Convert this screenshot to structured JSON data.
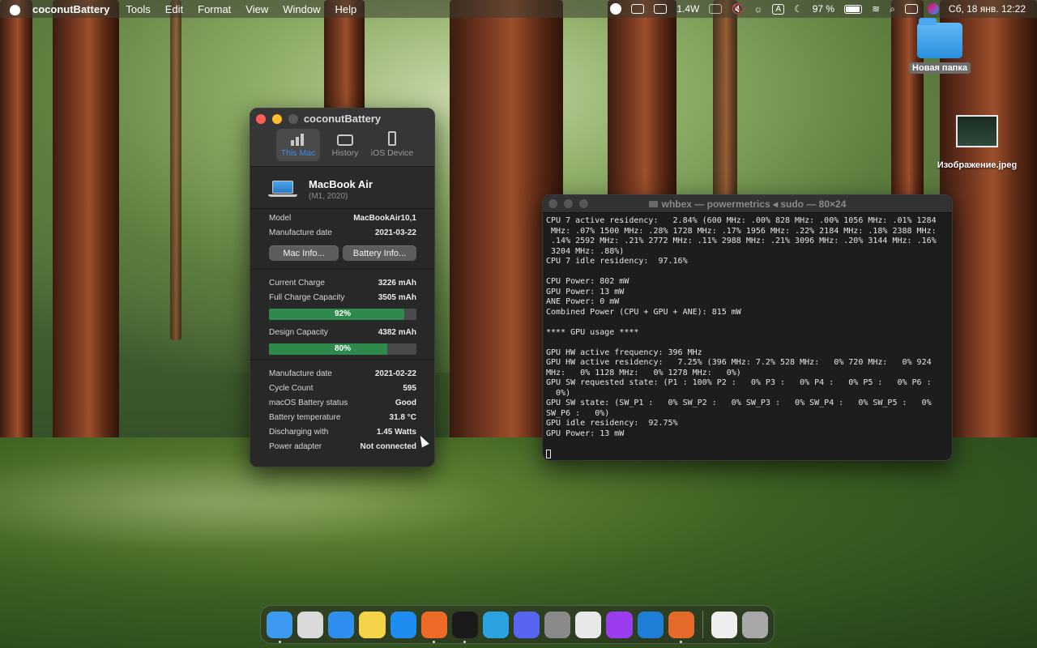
{
  "menubar": {
    "app_name": "coconutBattery",
    "menus": [
      "Tools",
      "Edit",
      "Format",
      "View",
      "Window",
      "Help"
    ],
    "power_readout": "1.4W",
    "keyboard_input": "A",
    "battery_percent": "97 %",
    "datetime": "Сб, 18 янв.  12:22"
  },
  "coconut": {
    "title": "coconutBattery",
    "tabs": [
      {
        "label": "This Mac",
        "active": true
      },
      {
        "label": "History",
        "active": false
      },
      {
        "label": "iOS Device",
        "active": false
      }
    ],
    "device_name": "MacBook Air",
    "device_sub": "(M1, 2020)",
    "model_label": "Model",
    "model_value": "MacBookAir10,1",
    "mfg_label": "Manufacture date",
    "mfg_value": "2021-03-22",
    "mac_info_btn": "Mac Info...",
    "battery_info_btn": "Battery Info...",
    "current_charge_label": "Current Charge",
    "current_charge_value": "3226 mAh",
    "full_charge_label": "Full Charge Capacity",
    "full_charge_value": "3505 mAh",
    "charge_bar_percent": 92,
    "charge_bar_label": "92%",
    "design_label": "Design Capacity",
    "design_value": "4382 mAh",
    "design_bar_percent": 80,
    "design_bar_label": "80%",
    "battery_mfg_label": "Manufacture date",
    "battery_mfg_value": "2021-02-22",
    "cycle_label": "Cycle Count",
    "cycle_value": "595",
    "status_label": "macOS Battery status",
    "status_value": "Good",
    "temp_label": "Battery temperature",
    "temp_value": "31.8 °C",
    "discharge_label": "Discharging with",
    "discharge_value": "1.45 Watts",
    "adapter_label": "Power adapter",
    "adapter_value": "Not connected"
  },
  "terminal": {
    "title": "whbex — powermetrics ◂ sudo — 80×24",
    "lines": [
      "CPU 7 active residency:   2.84% (600 MHz: .00% 828 MHz: .00% 1056 MHz: .01% 1284",
      " MHz: .07% 1500 MHz: .28% 1728 MHz: .17% 1956 MHz: .22% 2184 MHz: .18% 2388 MHz:",
      " .14% 2592 MHz: .21% 2772 MHz: .11% 2988 MHz: .21% 3096 MHz: .20% 3144 MHz: .16%",
      " 3204 MHz: .88%)",
      "CPU 7 idle residency:  97.16%",
      "",
      "CPU Power: 802 mW",
      "GPU Power: 13 mW",
      "ANE Power: 0 mW",
      "Combined Power (CPU + GPU + ANE): 815 mW",
      "",
      "**** GPU usage ****",
      "",
      "GPU HW active frequency: 396 MHz",
      "GPU HW active residency:   7.25% (396 MHz: 7.2% 528 MHz:   0% 720 MHz:   0% 924",
      "MHz:   0% 1128 MHz:   0% 1278 MHz:   0%)",
      "GPU SW requested state: (P1 : 100% P2 :   0% P3 :   0% P4 :   0% P5 :   0% P6 :",
      "  0%)",
      "GPU SW state: (SW_P1 :   0% SW_P2 :   0% SW_P3 :   0% SW_P4 :   0% SW_P5 :   0%",
      "SW_P6 :   0%)",
      "GPU idle residency:  92.75%",
      "GPU Power: 13 mW",
      ""
    ]
  },
  "desktop": {
    "folder_label": "Новая папка",
    "image_label": "Изображение.jpeg"
  },
  "dock": {
    "apps": [
      {
        "icon": "finder-icon",
        "color": "#3c9bf0",
        "running": true
      },
      {
        "icon": "launchpad-icon",
        "color": "#d9d9d9",
        "running": false
      },
      {
        "icon": "safari-icon",
        "color": "#2f8ff0",
        "running": false
      },
      {
        "icon": "notes-icon",
        "color": "#f5d44a",
        "running": false
      },
      {
        "icon": "app-store-icon",
        "color": "#1f8cf2",
        "running": false
      },
      {
        "icon": "firefox-icon",
        "color": "#ef6a26",
        "running": true
      },
      {
        "icon": "terminal-icon",
        "color": "#1a1a1a",
        "running": true
      },
      {
        "icon": "telegram-icon",
        "color": "#2aa3e0",
        "running": false
      },
      {
        "icon": "discord-icon",
        "color": "#5865f2",
        "running": false
      },
      {
        "icon": "system-settings-icon",
        "color": "#8a8a8a",
        "running": false
      },
      {
        "icon": "chatgpt-icon",
        "color": "#e8e8e8",
        "running": false
      },
      {
        "icon": "intellij-icon",
        "color": "#9b3cf0",
        "running": false
      },
      {
        "icon": "vscode-icon",
        "color": "#1f7fd6",
        "running": false
      },
      {
        "icon": "reeder-icon",
        "color": "#e4692a",
        "running": true
      }
    ],
    "trailing": [
      {
        "icon": "document-icon",
        "color": "#eeeeee"
      },
      {
        "icon": "trash-icon",
        "color": "#a8a8a8"
      }
    ]
  }
}
